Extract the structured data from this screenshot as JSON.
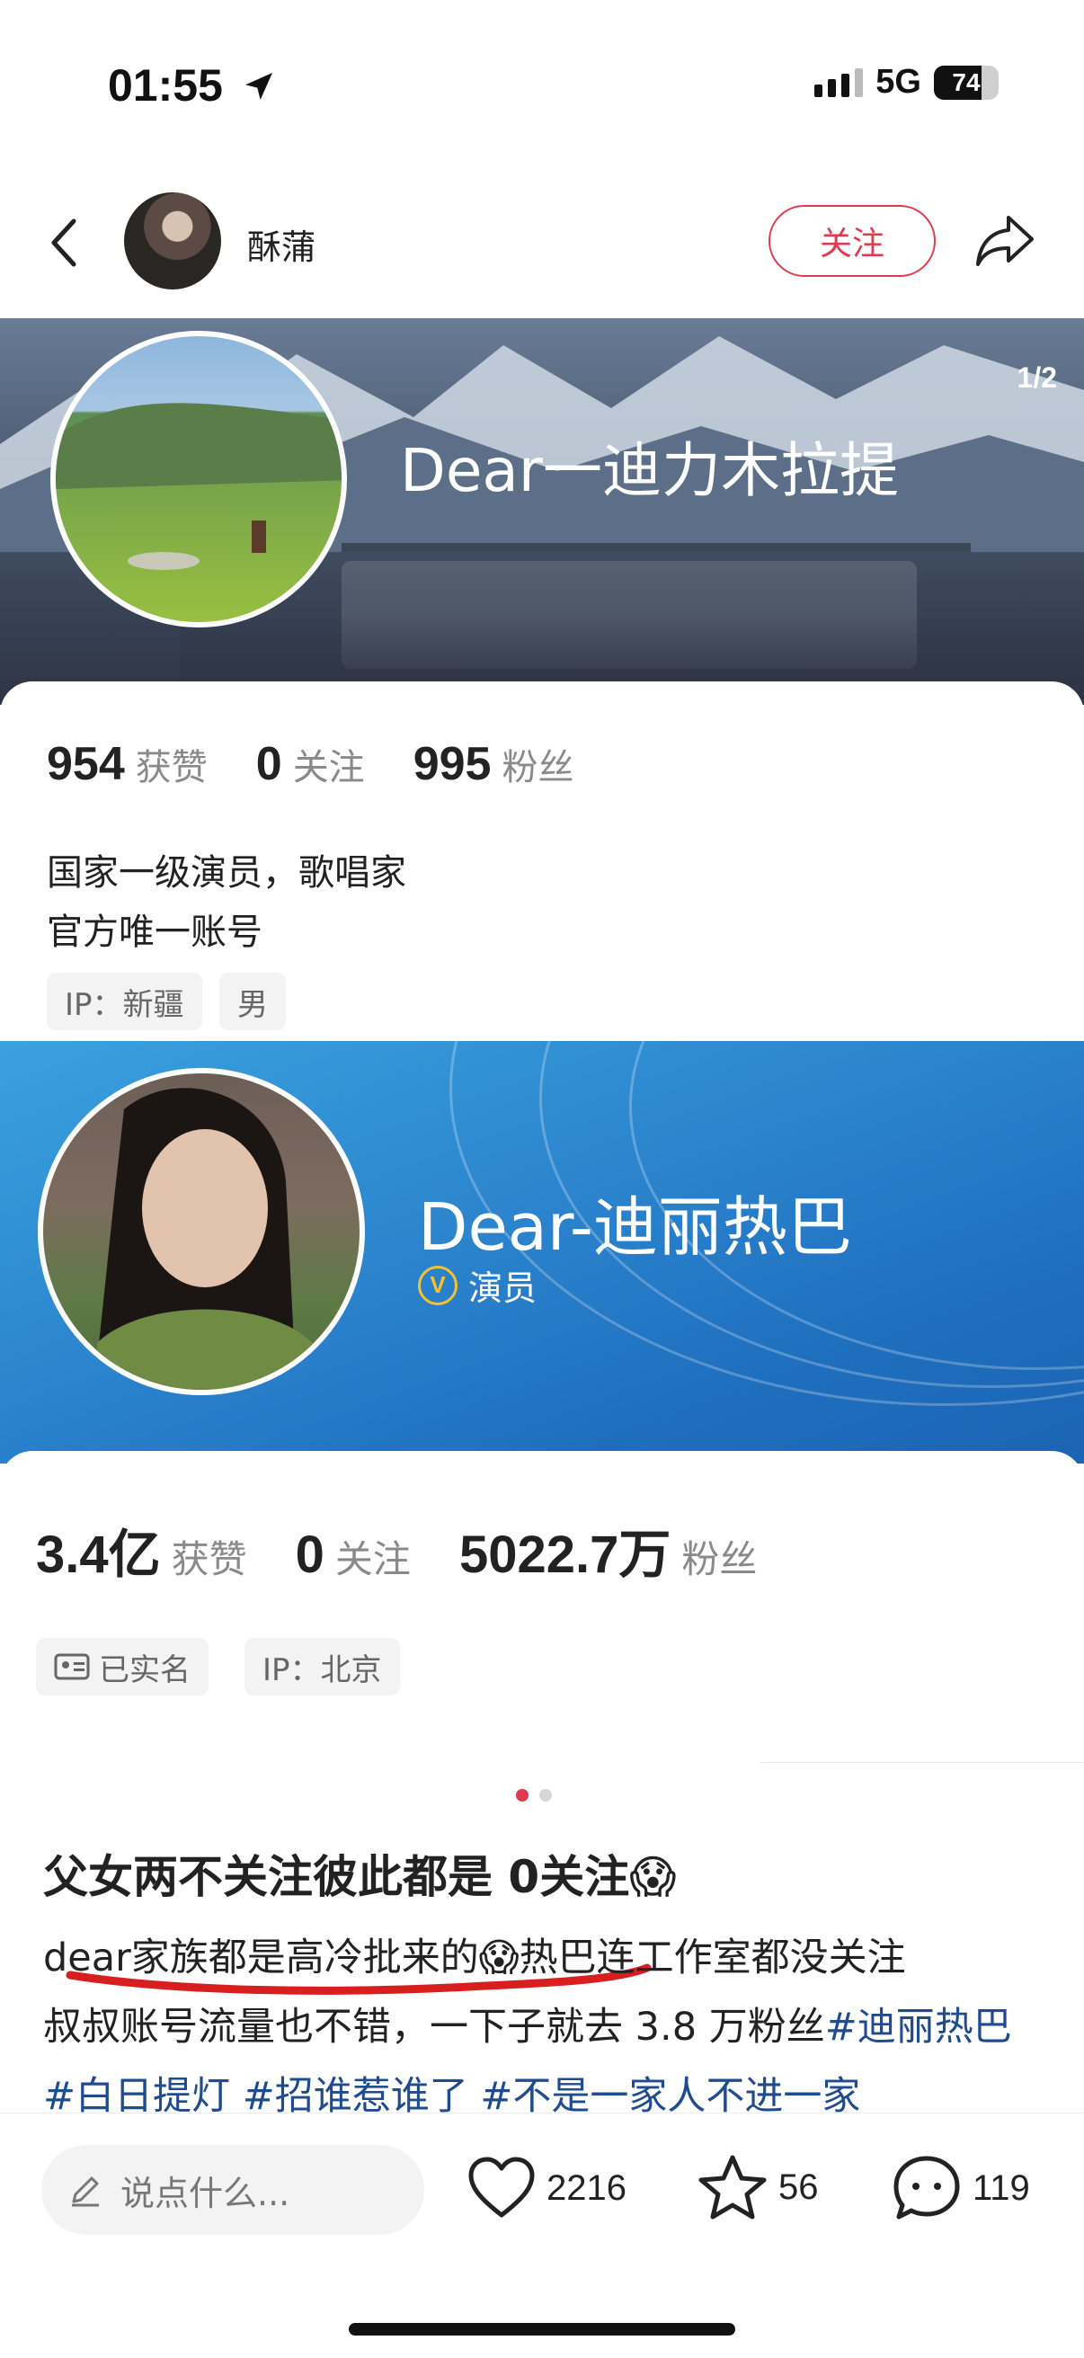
{
  "status_bar": {
    "time": "01:55",
    "network": "5G",
    "battery": "74",
    "battery_level": 0.74
  },
  "header": {
    "author_name": "酥蒲",
    "follow_label": "关注"
  },
  "image_carousel": {
    "indicator": "1/2",
    "active_index": 0,
    "total": 2
  },
  "profile_1": {
    "name": "Dear一迪力木拉提",
    "stats": [
      {
        "value": "954",
        "label": "获赞"
      },
      {
        "value": "0",
        "label": "关注"
      },
      {
        "value": "995",
        "label": "粉丝"
      }
    ],
    "bio": [
      "国家一级演员，歌唱家",
      "官方唯一账号"
    ],
    "tags": [
      "IP：新疆",
      "男"
    ]
  },
  "profile_2": {
    "name": "Dear-迪丽热巴",
    "verified_badge": "V",
    "role": "演员",
    "stats": [
      {
        "value": "3.4亿",
        "label": "获赞"
      },
      {
        "value": "0",
        "label": "关注"
      },
      {
        "value": "5022.7万",
        "label": "粉丝"
      }
    ],
    "tags": [
      "已实名",
      "IP：北京"
    ]
  },
  "note": {
    "title": "父女两不关注彼此都是 0关注",
    "title_emoji": "😱",
    "body_line1_a": "dear家族都是高冷批来的",
    "body_emoji": "😱",
    "body_line1_b": "热巴连工作室都没关注",
    "body_line2": "叔叔账号流量也不错，一下子就去 3.8 万粉丝",
    "hashtags": [
      "#迪丽热巴",
      "#白日提灯",
      "#招谁惹谁了",
      "#不是一家人不进一家"
    ]
  },
  "bottom_bar": {
    "comment_placeholder": "说点什么...",
    "likes": "2216",
    "favorites": "56",
    "comments": "119"
  },
  "colors": {
    "accent": "#e13a4f",
    "hashtag": "#1f4b8f",
    "banner2": "#2d87cf"
  }
}
